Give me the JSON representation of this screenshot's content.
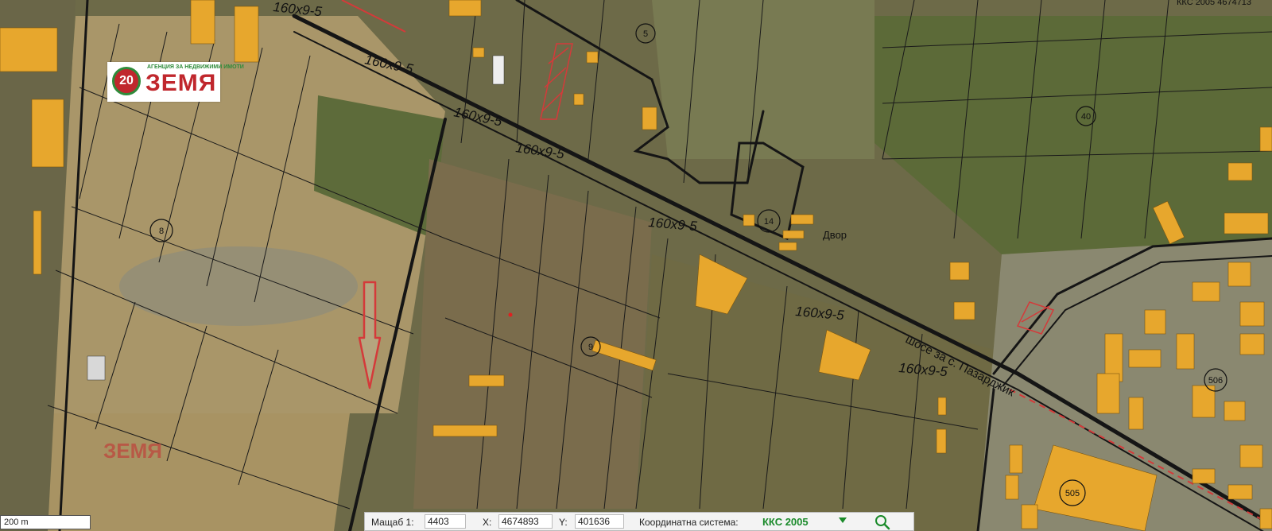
{
  "colors": {
    "building": "#e7a72d",
    "road": "#151515",
    "highlight": "#d43a3a",
    "field_dark": "#5f6a3c",
    "field_light": "#a99669"
  },
  "map": {
    "road_labels": [
      "160x9-5",
      "160x9-5",
      "160x9-5",
      "160x9-5",
      "160x9-5",
      "160x9-5",
      "160x9-5"
    ],
    "street_label": "шосе за с. Пазарджик",
    "place_label": "Двор",
    "parcel_numbers": [
      "5",
      "40",
      "14",
      "8",
      "9",
      "506",
      "505"
    ],
    "top_right_text": "ККС 2005 4674713"
  },
  "logo": {
    "badge": "20",
    "tagline": "АГЕНЦИЯ ЗА НЕДВИЖИМИ ИМОТИ",
    "name": "ЗЕМЯ"
  },
  "watermark": "ЗЕМЯ",
  "scale_bar": "200 m",
  "toolbar": {
    "scale_label": "Мащаб 1:",
    "scale_value": "4403",
    "x_label": "X:",
    "x_value": "4674893",
    "y_label": "Y:",
    "y_value": "401636",
    "system_label": "Координатна система:",
    "system_value": "ККС 2005",
    "dropdown_icon": "triangle-down-icon",
    "search_icon": "magnifier-icon"
  }
}
